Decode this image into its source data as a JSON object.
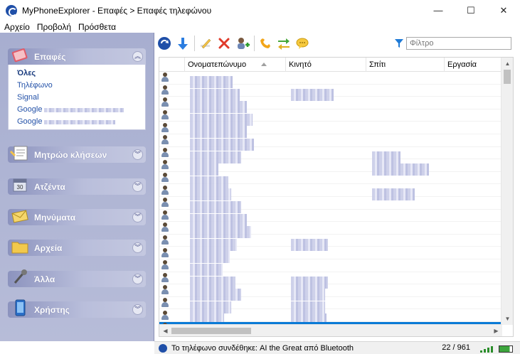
{
  "window": {
    "title": "MyPhoneExplorer -  Επαφές > Επαφές τηλεφώνου",
    "controls": {
      "minimize": "—",
      "maximize": "☐",
      "close": "✕"
    }
  },
  "menu": {
    "items": [
      "Αρχείο",
      "Προβολή",
      "Πρόσθετα"
    ]
  },
  "sidebar": {
    "sections": [
      {
        "label": "Επαφές",
        "icon": "contacts-book-icon",
        "expanded": true
      },
      {
        "label": "Μητρώο κλήσεων",
        "icon": "call-log-icon",
        "expanded": false
      },
      {
        "label": "Ατζέντα",
        "icon": "calendar-icon",
        "expanded": false
      },
      {
        "label": "Μηνύματα",
        "icon": "envelope-icon",
        "expanded": false
      },
      {
        "label": "Αρχεία",
        "icon": "folder-icon",
        "expanded": false
      },
      {
        "label": "Άλλα",
        "icon": "wrench-icon",
        "expanded": false
      },
      {
        "label": "Χρήστης",
        "icon": "phone-device-icon",
        "expanded": false
      }
    ],
    "contacts_items": [
      {
        "label": "Όλες",
        "active": true
      },
      {
        "label": "Τηλέφωνο",
        "active": false
      },
      {
        "label": "Signal",
        "active": false
      },
      {
        "label": "Google",
        "active": false
      },
      {
        "label": "Google",
        "active": false
      }
    ]
  },
  "toolbar": {
    "buttons": [
      "refresh-sync-icon",
      "download-arrow-icon",
      "edit-pencil-icon",
      "delete-x-icon",
      "add-contact-icon",
      "call-phone-icon",
      "transfer-arrows-icon",
      "message-bubble-icon"
    ],
    "filter_placeholder": "Φίλτρο"
  },
  "grid": {
    "columns": [
      "Ονοματεπώνυμο",
      "Κινητό",
      "Σπίτι",
      "Εργασία"
    ],
    "visible_rows": 22,
    "selected_row": 20,
    "last_row": {
      "name": "ΑΚΗΣ ΠΑΣ",
      "mobile": "6973302625"
    }
  },
  "status": {
    "text": "Το τηλέφωνο συνδέθηκε:  AI the Great από Bluetooth",
    "count": "22 / 961"
  },
  "colors": {
    "sidebar_bg": "#a7aed0",
    "selection": "#0a7ad6",
    "link": "#2452a8"
  }
}
